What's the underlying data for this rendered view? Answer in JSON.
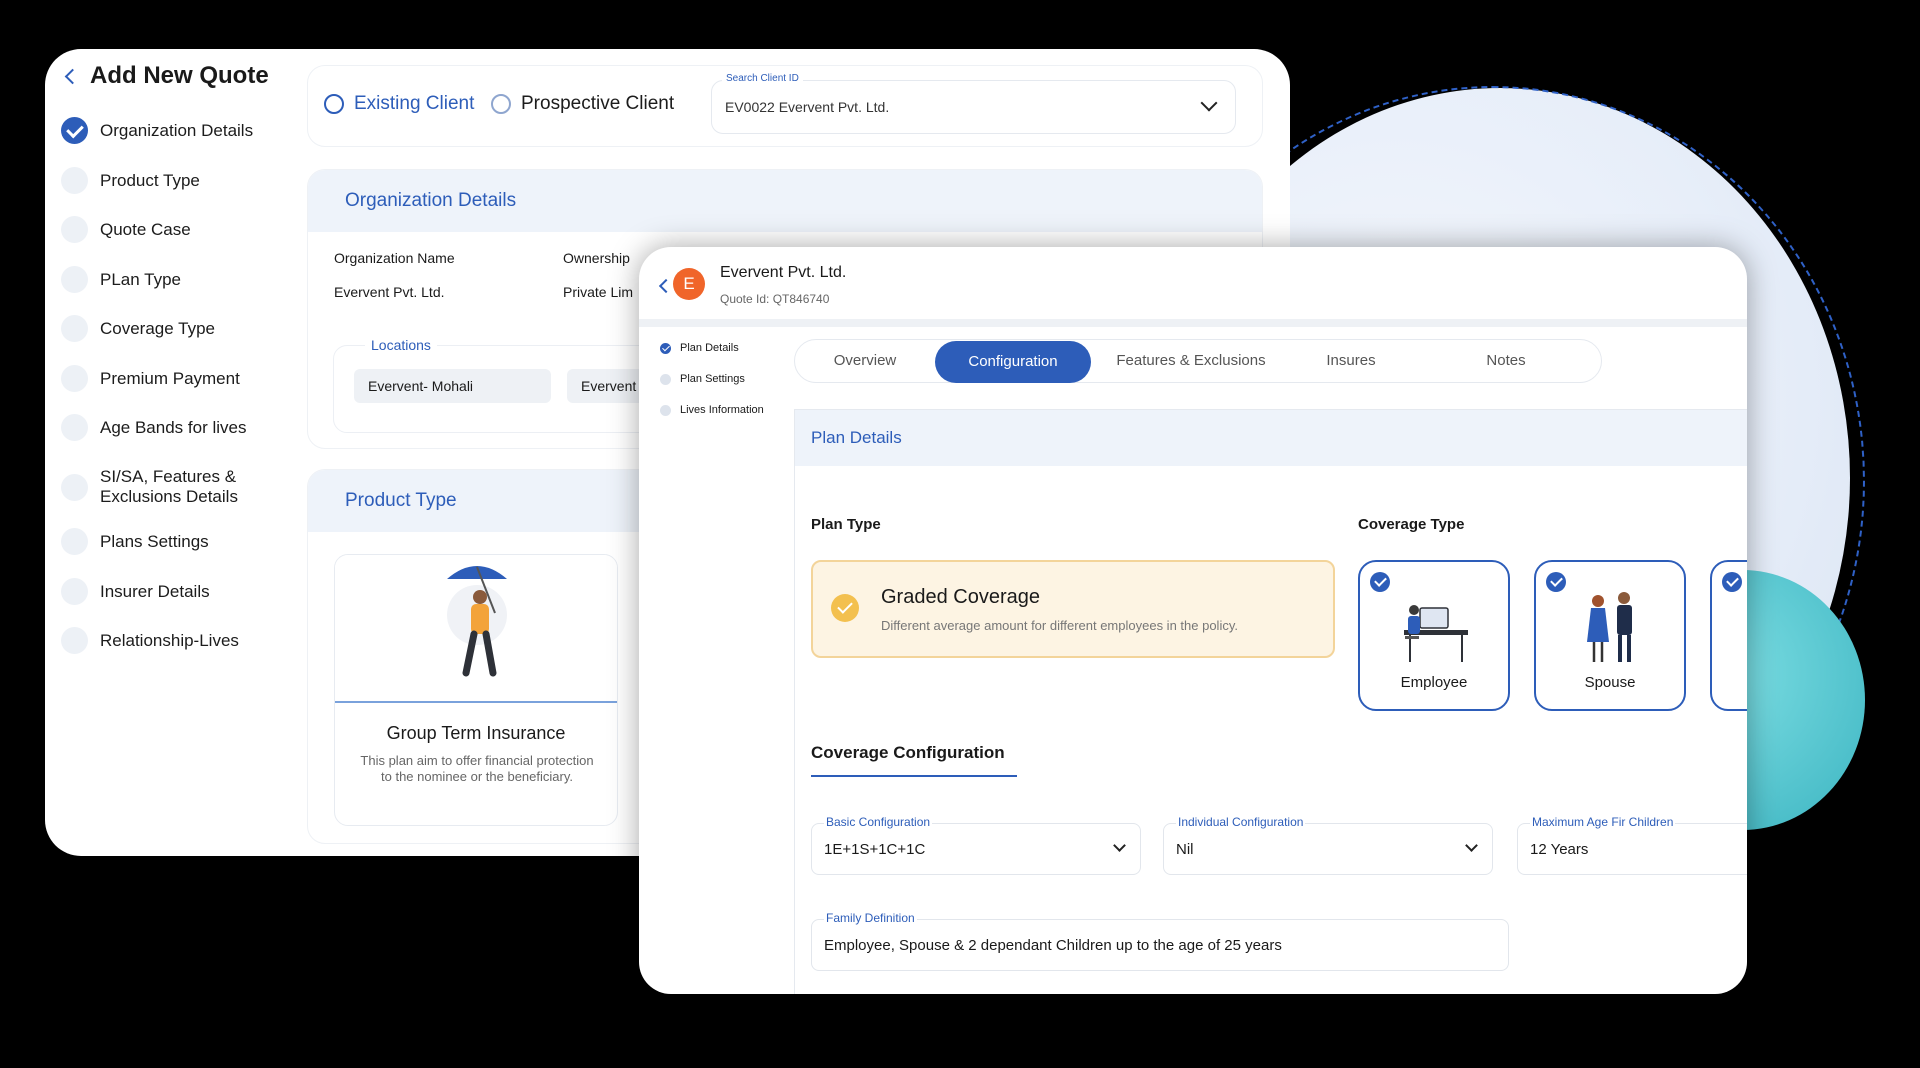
{
  "back": {
    "title": "Add New Quote",
    "steps": [
      {
        "label": "Organization Details",
        "done": true
      },
      {
        "label": "Product Type",
        "done": false
      },
      {
        "label": "Quote Case",
        "done": false
      },
      {
        "label": "PLan Type",
        "done": false
      },
      {
        "label": "Coverage Type",
        "done": false
      },
      {
        "label": "Premium Payment",
        "done": false
      },
      {
        "label": "Age Bands for lives",
        "done": false
      },
      {
        "label": "SI/SA, Features & Exclusions Details",
        "done": false
      },
      {
        "label": "Plans Settings",
        "done": false
      },
      {
        "label": "Insurer Details",
        "done": false
      },
      {
        "label": "Relationship-Lives",
        "done": false
      }
    ],
    "client": {
      "existing": "Existing Client",
      "prospective": "Prospective Client",
      "search_label": "Search Client ID",
      "search_value": "EV0022 Evervent Pvt. Ltd."
    },
    "org": {
      "title": "Organization Details",
      "name_label": "Organization Name",
      "name_value": "Evervent Pvt. Ltd.",
      "ownership_label": "Ownership",
      "ownership_value": "Private Lim",
      "locations_label": "Locations",
      "locations": [
        "Evervent- Mohali",
        "Evervent"
      ]
    },
    "product": {
      "title": "Product Type",
      "card_title": "Group Term Insurance",
      "card_desc": "This plan aim to offer financial protection to the nominee or the beneficiary."
    }
  },
  "front": {
    "avatar_letter": "E",
    "company": "Evervent Pvt. Ltd.",
    "quote_id": "Quote Id: QT846740",
    "sub_steps": [
      {
        "label": "Plan Details",
        "done": true
      },
      {
        "label": "Plan Settings",
        "done": false
      },
      {
        "label": "Lives Information",
        "done": false
      }
    ],
    "tabs": [
      "Overview",
      "Configuration",
      "Features & Exclusions",
      "Insures",
      "Notes"
    ],
    "active_tab": "Configuration",
    "plan": {
      "title": "Plan Details",
      "plan_type_label": "Plan Type",
      "coverage_type_label": "Coverage Type",
      "graded_title": "Graded Coverage",
      "graded_desc": "Different average amount for different employees in the policy.",
      "coverage_cards": [
        "Employee",
        "Spouse"
      ],
      "config_title": "Coverage Configuration",
      "basic_label": "Basic Configuration",
      "basic_value": "1E+1S+1C+1C",
      "individual_label": "Individual Configuration",
      "individual_value": "Nil",
      "max_age_label": "Maximum Age Fir Children",
      "max_age_value": "12 Years",
      "family_label": "Family Definition",
      "family_value": "Employee, Spouse & 2 dependant Children up to the age of 25 years"
    }
  },
  "colors": {
    "accent": "#2d5db9",
    "highlight": "#f3c04f",
    "avatar": "#f0652a",
    "teal": "#3bb4c1"
  },
  "icons": [
    "chevron-left-icon",
    "check-circle-icon",
    "chevron-down-icon",
    "umbrella-person-illustration",
    "employee-desk-illustration",
    "couple-illustration"
  ]
}
